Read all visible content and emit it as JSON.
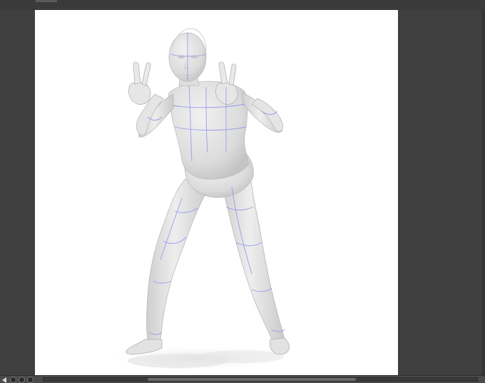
{
  "window": {
    "background": "#3d3d3d",
    "canvas_background": "#ffffff"
  },
  "canvas": {
    "content": "3d-mannequin-figure",
    "pose": "peace-sign-crouch",
    "mannequin_color": "#d9d9d9",
    "guide_line_color": "#8f8ff0"
  },
  "status_bar": {
    "buttons": [
      {
        "icon": "left-arrow-icon"
      },
      {
        "icon": "zoom-in-icon"
      },
      {
        "icon": "zoom-out-icon"
      },
      {
        "icon": "rotate-icon"
      }
    ],
    "horizontal_scroll": {
      "position_fraction": 0.24,
      "visible_fraction": 0.48
    }
  }
}
